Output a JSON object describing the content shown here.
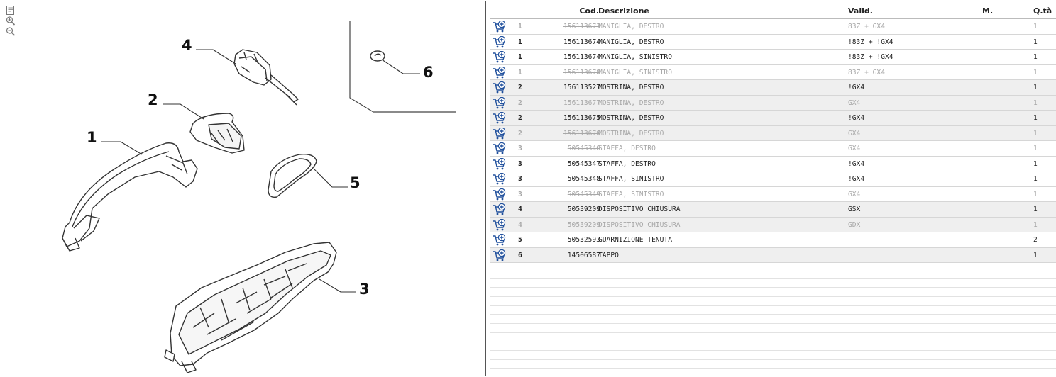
{
  "diagram": {
    "tools": [
      {
        "name": "fit-page-icon"
      },
      {
        "name": "zoom-in-icon"
      },
      {
        "name": "zoom-out-icon"
      }
    ],
    "callouts": [
      "1",
      "2",
      "3",
      "4",
      "5",
      "6"
    ]
  },
  "table": {
    "headers": {
      "code": "Cod.",
      "description": "Descrizione",
      "valid": "Valid.",
      "m": "M.",
      "qty": "Q.tà"
    },
    "rows": [
      {
        "pos": "1",
        "code": "156113673",
        "desc": "MANIGLIA, DESTRO",
        "valid": "83Z + GX4",
        "qty": "1",
        "dim": true
      },
      {
        "pos": "1",
        "code": "156113674",
        "desc": "MANIGLIA, DESTRO",
        "valid": "!83Z + !GX4",
        "qty": "1",
        "dim": false
      },
      {
        "pos": "1",
        "code": "156113674",
        "desc": "MANIGLIA, SINISTRO",
        "valid": "!83Z + !GX4",
        "qty": "1",
        "dim": false
      },
      {
        "pos": "1",
        "code": "156113678",
        "desc": "MANIGLIA, SINISTRO",
        "valid": "83Z + GX4",
        "qty": "1",
        "dim": true
      },
      {
        "pos": "2",
        "code": "156113527",
        "desc": "MOSTRINA, DESTRO",
        "valid": "!GX4",
        "qty": "1",
        "dim": false
      },
      {
        "pos": "2",
        "code": "156113677",
        "desc": "MOSTRINA, DESTRO",
        "valid": "GX4",
        "qty": "1",
        "dim": true
      },
      {
        "pos": "2",
        "code": "156113675",
        "desc": "MOSTRINA, DESTRO",
        "valid": "!GX4",
        "qty": "1",
        "dim": false
      },
      {
        "pos": "2",
        "code": "156113676",
        "desc": "MOSTRINA, DESTRO",
        "valid": "GX4",
        "qty": "1",
        "dim": true
      },
      {
        "pos": "3",
        "code": "50545346",
        "desc": "STAFFA, DESTRO",
        "valid": "GX4",
        "qty": "1",
        "dim": true
      },
      {
        "pos": "3",
        "code": "50545347",
        "desc": "STAFFA, DESTRO",
        "valid": "!GX4",
        "qty": "1",
        "dim": false
      },
      {
        "pos": "3",
        "code": "50545348",
        "desc": "STAFFA, SINISTRO",
        "valid": "!GX4",
        "qty": "1",
        "dim": false
      },
      {
        "pos": "3",
        "code": "50545349",
        "desc": "STAFFA, SINISTRO",
        "valid": "GX4",
        "qty": "1",
        "dim": true
      },
      {
        "pos": "4",
        "code": "50539209",
        "desc": "DISPOSITIVO CHIUSURA",
        "valid": "GSX",
        "qty": "1",
        "dim": false
      },
      {
        "pos": "4",
        "code": "50539209",
        "desc": "DISPOSITIVO CHIUSURA",
        "valid": "GDX",
        "qty": "1",
        "dim": true
      },
      {
        "pos": "5",
        "code": "50532593",
        "desc": "GUARNIZIONE TENUTA",
        "valid": "",
        "qty": "2",
        "dim": false
      },
      {
        "pos": "6",
        "code": "14506587",
        "desc": "TAPPO",
        "valid": "",
        "qty": "1",
        "dim": false
      }
    ],
    "colors": {
      "active_text": "#222222",
      "dim_text": "#a8a8a8",
      "alt_row": "#efefef",
      "cart_icon": "#1f4f9c"
    }
  }
}
